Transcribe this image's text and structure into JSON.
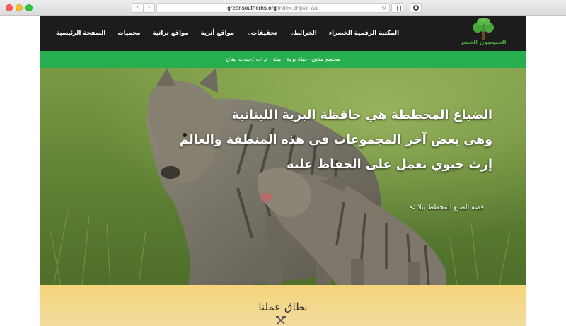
{
  "browser": {
    "url_host": "greensoutherns.org",
    "url_path": "/index.php/ar-aa/",
    "back_icon": "chevron-left-icon",
    "forward_icon": "chevron-right-icon",
    "reload_icon": "reload-icon"
  },
  "site": {
    "logo_text": "الجنوبيون الخضر",
    "menu": [
      {
        "label": "الصفحة الرئيسية",
        "dropdown": false
      },
      {
        "label": "محميات",
        "dropdown": false
      },
      {
        "label": "مواقع تراثية",
        "dropdown": false
      },
      {
        "label": "مواقع أثرية",
        "dropdown": false
      },
      {
        "label": "تحقيقات",
        "dropdown": true
      },
      {
        "label": "الخرائط",
        "dropdown": true
      },
      {
        "label": "المكتبة الرقمية الخضراء",
        "dropdown": false
      }
    ],
    "dropdown_chevron": "⌵",
    "tagline": "مجتمع مدني- حياة برية - بيئة - تراث /جنوب لبنان"
  },
  "hero": {
    "headline_line1": "الضباع المخططة هي حافظة البرية اللبنانية",
    "headline_line2": "وهي بعض آخر المجموعات في هذه المنطقة والعالم",
    "headline_line3": "إرث حيوي نعمل على الحفاظ عليه",
    "link_text": "قصة الضبع المخطط بيلا",
    "link_arrow": ">"
  },
  "section": {
    "title": "نطاق عملنا",
    "icon": "tools-icon"
  },
  "colors": {
    "nav_bg": "#1c1c1c",
    "accent_green": "#27ae4f",
    "section_bg": "#f6d47a"
  }
}
